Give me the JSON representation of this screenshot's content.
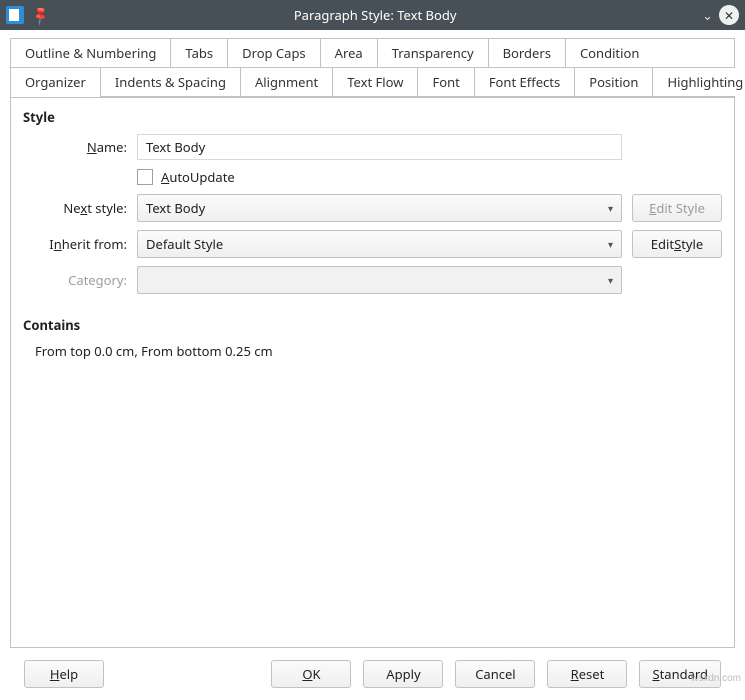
{
  "titlebar": {
    "title": "Paragraph Style: Text Body"
  },
  "tabs_row1": [
    "Outline & Numbering",
    "Tabs",
    "Drop Caps",
    "Area",
    "Transparency",
    "Borders",
    "Condition"
  ],
  "tabs_row2": [
    "Organizer",
    "Indents & Spacing",
    "Alignment",
    "Text Flow",
    "Font",
    "Font Effects",
    "Position",
    "Highlighting"
  ],
  "active_tab": "Organizer",
  "section_style_title": "Style",
  "labels": {
    "name": {
      "pre": "",
      "u": "N",
      "post": "ame:"
    },
    "autoupdate": {
      "pre": "",
      "u": "A",
      "post": "utoUpdate"
    },
    "nextstyle": {
      "pre": "Ne",
      "u": "x",
      "post": "t style:"
    },
    "inherit": {
      "pre": "I",
      "u": "n",
      "post": "herit from:"
    },
    "category": "Category:",
    "editstyle1": {
      "pre": "",
      "u": "E",
      "post": "dit Style"
    },
    "editstyle2": {
      "pre": "Edit ",
      "u": "S",
      "post": "tyle"
    }
  },
  "values": {
    "name": "Text Body",
    "autoupdate": false,
    "nextstyle": "Text Body",
    "inherit": "Default Style",
    "category": ""
  },
  "section_contains_title": "Contains",
  "contains_text": "From top 0.0 cm, From bottom 0.25 cm",
  "buttons": {
    "help": {
      "pre": "",
      "u": "H",
      "post": "elp"
    },
    "ok": {
      "pre": "",
      "u": "O",
      "post": "K"
    },
    "apply": "Apply",
    "cancel": "Cancel",
    "reset": {
      "pre": "",
      "u": "R",
      "post": "eset"
    },
    "standard": {
      "pre": "",
      "u": "S",
      "post": "tandard"
    }
  },
  "watermark": "wsxdn.com"
}
